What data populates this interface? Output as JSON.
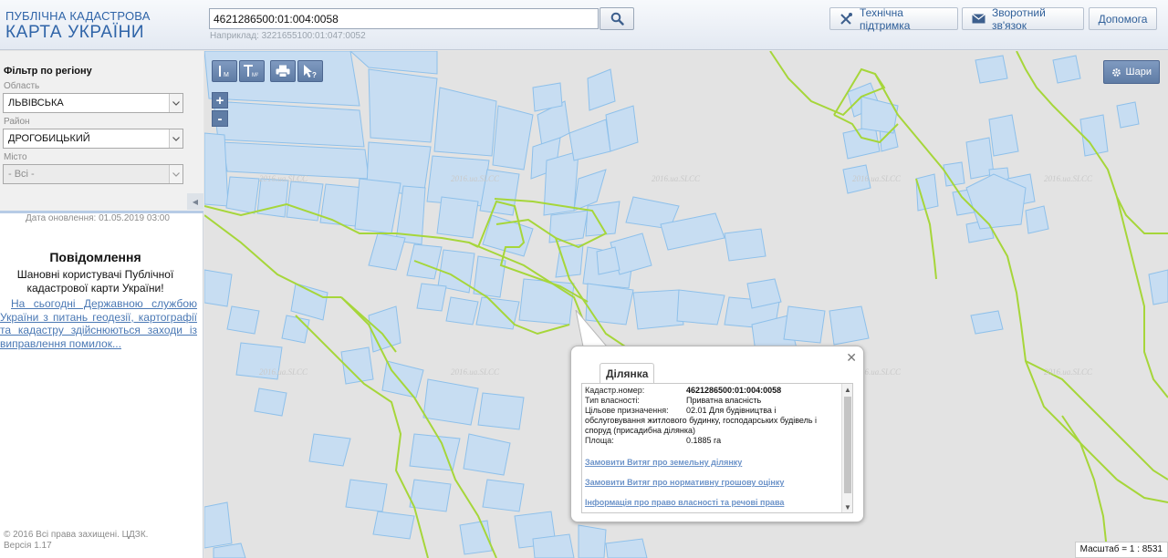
{
  "header": {
    "logo_line1": "ПУБЛІЧНА КАДАСТРОВА",
    "logo_line2": "КАРТА УКРАЇНИ",
    "search_value": "4621286500:01:004:0058",
    "search_hint": "Наприклад: 3221655100:01:047:0052",
    "support_label": "Технічна підтримка",
    "feedback_label": "Зворотний зв'язок",
    "help_label": "Допомога"
  },
  "sidebar": {
    "filter_title": "Фільтр по регіону",
    "oblast_label": "Область",
    "oblast_value": "ЛЬВІВСЬКА",
    "rayon_label": "Район",
    "rayon_value": "ДРОГОБИЦЬКИЙ",
    "city_label": "Місто",
    "city_value": "- Всі -",
    "update_date": "Дата оновлення: 01.05.2019 03:00",
    "notice_title": "Повідомлення",
    "notice_text": "Шановні користувачі Публічної кадастрової карти України!",
    "notice_link": "На сьогодні Державною службою України з питань геодезії, картографії та кадастру здійснюються заходи із виправлення помилок...",
    "copyright": "© 2016 Всі права захищені. ЦДЗК. Версія 1.17"
  },
  "map": {
    "layers_label": "Шари",
    "scale_text": "Масштаб = 1 : 8531",
    "watermark": "2016.ua.SLCC",
    "parcel_fill": "#c7ddf2",
    "parcel_stroke": "#8ec0ea",
    "boundary_color": "#a6d63a"
  },
  "popup": {
    "tab_label": "Ділянка",
    "rows": [
      {
        "label": "Кадастр.номер:",
        "value": "4621286500:01:004:0058"
      },
      {
        "label": "Тип власності:",
        "value": "Приватна власність"
      },
      {
        "label": "Цільове призначення:",
        "value": "02.01 Для будівництва і обслуговування житлового будинку, господарських будівель і споруд (присадибна ділянка)"
      },
      {
        "label": "Площа:",
        "value": "0.1885 га"
      }
    ],
    "links": [
      "Замовити Витяг про земельну ділянку",
      "Замовити Витяг про нормативну грошову оцінку",
      "Інформація про право власності та речові права"
    ]
  }
}
